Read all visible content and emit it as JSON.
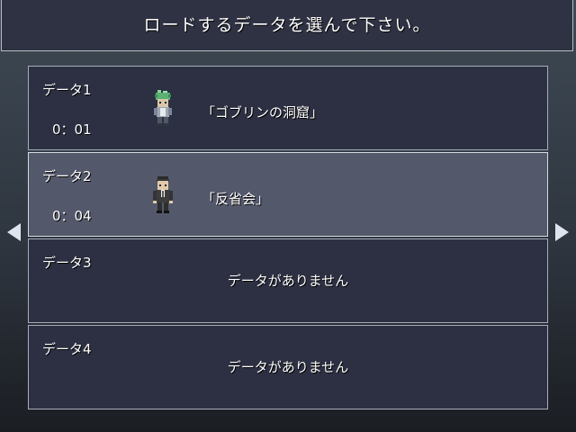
{
  "header": {
    "title": "ロードするデータを選んで下さい。"
  },
  "slots": [
    {
      "label": "データ1",
      "time": "0：01",
      "location": "「ゴブリンの洞窟」",
      "sprite": "goblin-icon"
    },
    {
      "label": "データ2",
      "time": "0：04",
      "location": "「反省会」",
      "sprite": "businessman-icon",
      "selected": true
    },
    {
      "label": "データ3",
      "empty_text": "データがありません"
    },
    {
      "label": "データ4",
      "empty_text": "データがありません"
    }
  ],
  "navigation": {
    "prev_icon": "arrow-left-icon",
    "next_icon": "arrow-right-icon"
  },
  "colors": {
    "window_bg": "#2d3042",
    "selected_bg": "#54586b",
    "border": "#a9adba",
    "text": "#ffffff"
  }
}
